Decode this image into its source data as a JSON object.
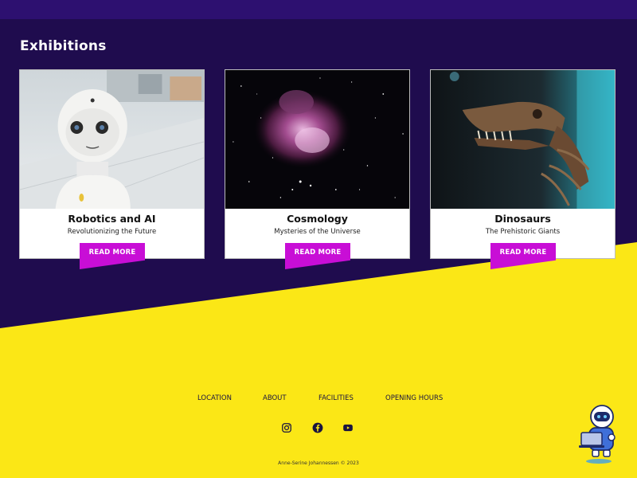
{
  "section": {
    "title": "Exhibitions"
  },
  "cards": [
    {
      "title": "Robotics and AI",
      "subtitle": "Revolutionizing the Future",
      "button": "READ MORE"
    },
    {
      "title": "Cosmology",
      "subtitle": "Mysteries of the Universe",
      "button": "READ MORE"
    },
    {
      "title": "Dinosaurs",
      "subtitle": "The Prehistoric Giants",
      "button": "READ MORE"
    }
  ],
  "footer": {
    "nav": [
      "LOCATION",
      "ABOUT",
      "FACILITIES",
      "OPENING HOURS"
    ],
    "social": [
      "instagram-icon",
      "facebook-icon",
      "youtube-icon"
    ],
    "copyright": "Anne-Serine Johannessen © 2023"
  },
  "colors": {
    "background": "#1f0c4e",
    "top_bar": "#2d1070",
    "footer_bg": "#fbe716",
    "button": "#c80ed6"
  }
}
